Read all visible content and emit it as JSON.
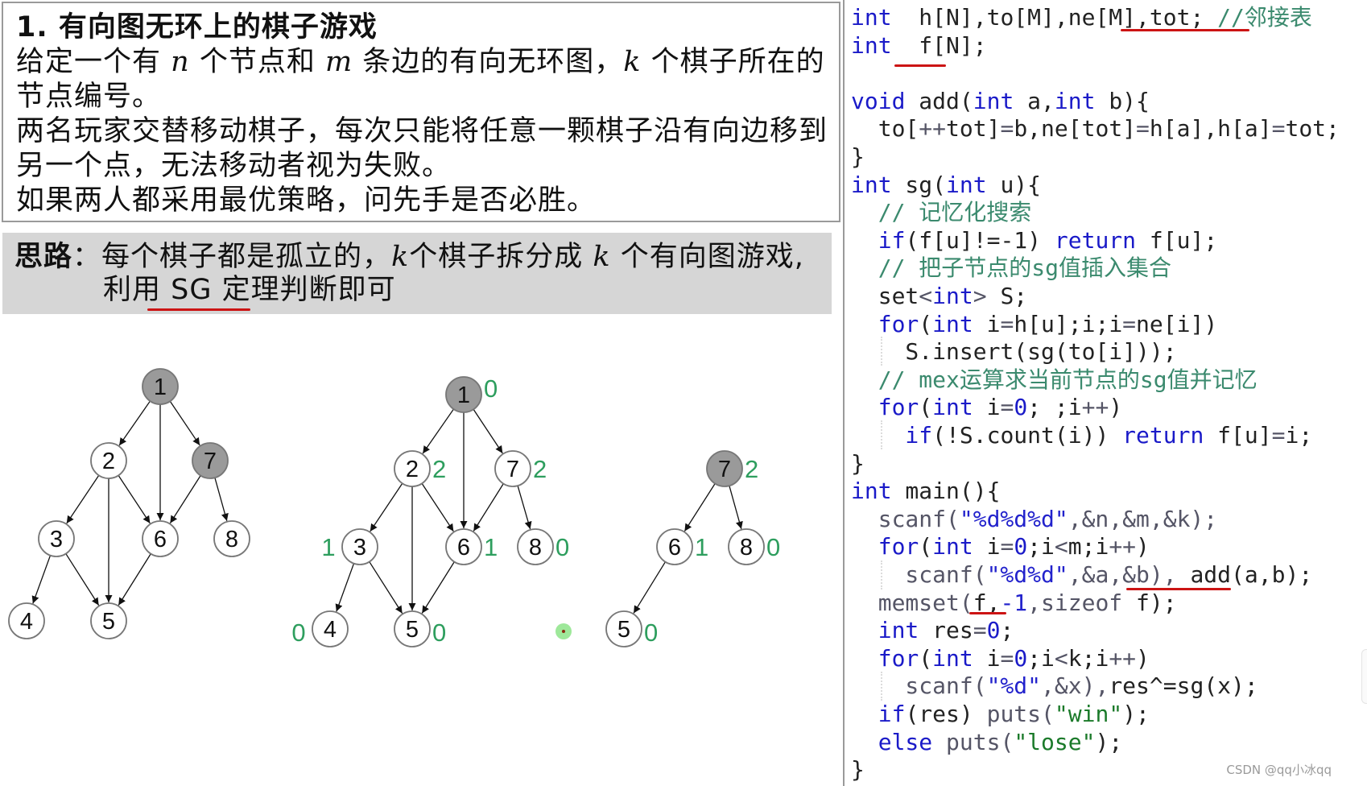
{
  "problem": {
    "title": "1. 有向图无环上的棋子游戏",
    "lines": [
      [
        "给定一个有 ",
        "n",
        " 个节点和 ",
        "m",
        " 条边的有向无环图，",
        "k",
        " 个棋子所在的"
      ],
      [
        "节点编号。"
      ],
      [
        "两名玩家交替移动棋子，每次只能将任意一颗棋子沿有向边移到"
      ],
      [
        "另一个点，无法移动者视为失败。"
      ],
      [
        "如果两人都采用最优策略，问先手是否必胜。"
      ]
    ]
  },
  "hint": {
    "label": "思路",
    "colon": "：",
    "line1_a": "每个棋子都是孤立的，",
    "line1_k1": "k",
    "line1_b": "个棋子拆分成 ",
    "line1_k2": "k",
    "line1_c": " 个有向图游戏,",
    "line2": "利用 SG 定理判断即可"
  },
  "graphs": {
    "colors": {
      "highlight_fill": "#9a9a9a",
      "node_fill": "#ffffff",
      "node_stroke": "#777777",
      "sg_label": "#2e9e5e",
      "edge": "#111111"
    },
    "graph1": {
      "nodes": [
        {
          "id": "1",
          "highlight": true
        },
        {
          "id": "2"
        },
        {
          "id": "7",
          "highlight": true
        },
        {
          "id": "3"
        },
        {
          "id": "6"
        },
        {
          "id": "8"
        },
        {
          "id": "4"
        },
        {
          "id": "5"
        }
      ],
      "edges": [
        [
          "1",
          "2"
        ],
        [
          "1",
          "6"
        ],
        [
          "1",
          "7"
        ],
        [
          "2",
          "3"
        ],
        [
          "2",
          "5"
        ],
        [
          "2",
          "6"
        ],
        [
          "7",
          "6"
        ],
        [
          "7",
          "8"
        ],
        [
          "3",
          "4"
        ],
        [
          "3",
          "5"
        ],
        [
          "6",
          "5"
        ]
      ]
    },
    "graph2": {
      "nodes": [
        {
          "id": "1",
          "highlight": true,
          "sg": "0"
        },
        {
          "id": "2",
          "sg": "2"
        },
        {
          "id": "7",
          "sg": "2"
        },
        {
          "id": "3",
          "sg": "1"
        },
        {
          "id": "6",
          "sg": "1"
        },
        {
          "id": "8",
          "sg": "0"
        },
        {
          "id": "4",
          "sg": "0"
        },
        {
          "id": "5",
          "sg": "0"
        }
      ],
      "edges": [
        [
          "1",
          "2"
        ],
        [
          "1",
          "6"
        ],
        [
          "1",
          "7"
        ],
        [
          "2",
          "3"
        ],
        [
          "2",
          "5"
        ],
        [
          "2",
          "6"
        ],
        [
          "7",
          "6"
        ],
        [
          "7",
          "8"
        ],
        [
          "3",
          "4"
        ],
        [
          "3",
          "5"
        ],
        [
          "6",
          "5"
        ]
      ]
    },
    "graph3": {
      "nodes": [
        {
          "id": "7",
          "highlight": true,
          "sg": "2"
        },
        {
          "id": "6",
          "sg": "1"
        },
        {
          "id": "8",
          "sg": "0"
        },
        {
          "id": "5",
          "sg": "0"
        }
      ],
      "edges": [
        [
          "7",
          "6"
        ],
        [
          "7",
          "8"
        ],
        [
          "6",
          "5"
        ]
      ]
    }
  },
  "code": {
    "lines": [
      [
        [
          "kw",
          "int"
        ],
        [
          "",
          "  h[N],to[M],ne[M],tot; "
        ],
        [
          "cm",
          "//邻接表"
        ]
      ],
      [
        [
          "kw",
          "int"
        ],
        [
          "",
          "  f[N];"
        ]
      ],
      [],
      [
        [
          "kw",
          "void"
        ],
        [
          "",
          " add("
        ],
        [
          "kw",
          "int"
        ],
        [
          "",
          " a,"
        ],
        [
          "kw",
          "int"
        ],
        [
          "",
          " b){"
        ]
      ],
      [
        [
          "",
          "  to["
        ],
        [
          "gray",
          "++"
        ],
        [
          "",
          "tot]"
        ],
        [
          "gray",
          "="
        ],
        [
          "",
          "b,ne[tot]"
        ],
        [
          "gray",
          "="
        ],
        [
          "",
          "h[a],h[a]"
        ],
        [
          "gray",
          "="
        ],
        [
          "",
          "tot;"
        ]
      ],
      [
        [
          "",
          "}"
        ]
      ],
      [
        [
          "kw",
          "int"
        ],
        [
          "",
          " sg("
        ],
        [
          "kw",
          "int"
        ],
        [
          "",
          " u){"
        ]
      ],
      [
        [
          "cm",
          "  // 记忆化搜索"
        ]
      ],
      [
        [
          "kw",
          "  if"
        ],
        [
          "",
          "(f[u]!=-1) "
        ],
        [
          "kw",
          "return"
        ],
        [
          "",
          " f[u];"
        ]
      ],
      [
        [
          "cm",
          "  // 把子节点的sg值插入集合"
        ]
      ],
      [
        [
          "",
          "  set"
        ],
        [
          "gray",
          "<"
        ],
        [
          "kw",
          "int"
        ],
        [
          "gray",
          ">"
        ],
        [
          "",
          " S;"
        ]
      ],
      [
        [
          "kw",
          "  for"
        ],
        [
          "",
          "("
        ],
        [
          "kw",
          "int"
        ],
        [
          "",
          " i"
        ],
        [
          "gray",
          "="
        ],
        [
          "",
          "h[u];i;i"
        ],
        [
          "gray",
          "="
        ],
        [
          "",
          "ne[i])"
        ]
      ],
      [
        [
          "",
          "    S.insert(sg(to[i]));"
        ]
      ],
      [
        [
          "cm",
          "  // mex运算求当前节点的sg值并记忆"
        ]
      ],
      [
        [
          "kw",
          "  for"
        ],
        [
          "",
          "("
        ],
        [
          "kw",
          "int"
        ],
        [
          "",
          " i"
        ],
        [
          "gray",
          "="
        ],
        [
          "kw",
          "0"
        ],
        [
          "",
          "; ;i"
        ],
        [
          "gray",
          "++"
        ],
        [
          "",
          ")"
        ]
      ],
      [
        [
          "kw",
          "    if"
        ],
        [
          "",
          "(!S.count(i)) "
        ],
        [
          "kw",
          "return"
        ],
        [
          "",
          " f[u]"
        ],
        [
          "gray",
          "="
        ],
        [
          "",
          "i;"
        ]
      ],
      [
        [
          "",
          "}"
        ]
      ],
      [
        [
          "kw",
          "int"
        ],
        [
          "",
          " main(){"
        ]
      ],
      [
        [
          "gray",
          "  scanf("
        ],
        [
          "str",
          "\"%d%d%d\""
        ],
        [
          "gray",
          ",&n,&m,&k);"
        ]
      ],
      [
        [
          "kw",
          "  for"
        ],
        [
          "",
          "("
        ],
        [
          "kw",
          "int"
        ],
        [
          "",
          " i"
        ],
        [
          "gray",
          "="
        ],
        [
          "kw",
          "0"
        ],
        [
          "",
          ";i"
        ],
        [
          "gray",
          "<"
        ],
        [
          "",
          "m;i"
        ],
        [
          "gray",
          "++"
        ],
        [
          "",
          ")"
        ]
      ],
      [
        [
          "gray",
          "    scanf("
        ],
        [
          "str",
          "\"%d%d\""
        ],
        [
          "gray",
          ",&a,&b), "
        ],
        [
          "",
          "add(a,b);"
        ]
      ],
      [
        [
          "gray",
          "  memset("
        ],
        [
          "",
          "f,"
        ],
        [
          "str",
          "-1"
        ],
        [
          "gray",
          ",sizeof "
        ],
        [
          "",
          "f);"
        ]
      ],
      [
        [
          "kw",
          "  int"
        ],
        [
          "",
          " res"
        ],
        [
          "gray",
          "="
        ],
        [
          "kw",
          "0"
        ],
        [
          "",
          ";"
        ]
      ],
      [
        [
          "kw",
          "  for"
        ],
        [
          "",
          "("
        ],
        [
          "kw",
          "int"
        ],
        [
          "",
          " i"
        ],
        [
          "gray",
          "="
        ],
        [
          "kw",
          "0"
        ],
        [
          "",
          ";i"
        ],
        [
          "gray",
          "<"
        ],
        [
          "",
          "k;i"
        ],
        [
          "gray",
          "++"
        ],
        [
          "",
          ")"
        ]
      ],
      [
        [
          "gray",
          "    scanf("
        ],
        [
          "str",
          "\"%d\""
        ],
        [
          "gray",
          ",&x),"
        ],
        [
          "",
          "res^=sg(x);"
        ]
      ],
      [
        [
          "kw",
          "  if"
        ],
        [
          "",
          "(res) "
        ],
        [
          "gray",
          "puts("
        ],
        [
          "strg",
          "\"win\""
        ],
        [
          "",
          ");"
        ]
      ],
      [
        [
          "kw",
          "  else"
        ],
        [
          "",
          " "
        ],
        [
          "gray",
          "puts("
        ],
        [
          "strg",
          "\"lose\""
        ],
        [
          "",
          ");"
        ]
      ],
      [
        [
          "",
          "}"
        ]
      ]
    ]
  },
  "watermark": "CSDN @qq小冰qq"
}
